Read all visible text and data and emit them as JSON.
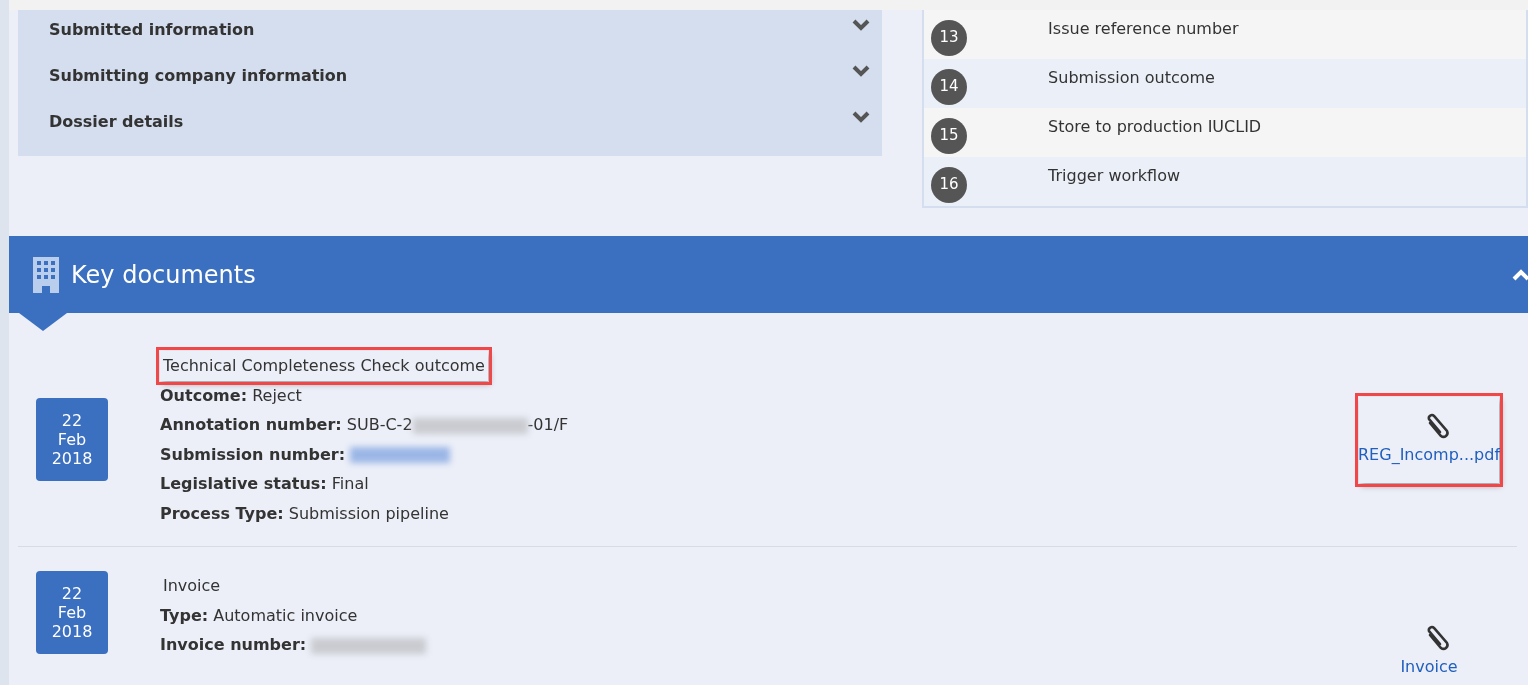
{
  "accordion": [
    {
      "title": "Submitted information",
      "expanded": false
    },
    {
      "title": "Submitting company information",
      "expanded": false
    },
    {
      "title": "Dossier details",
      "expanded": false
    }
  ],
  "steps": [
    {
      "number": "13",
      "label": "Issue reference number"
    },
    {
      "number": "14",
      "label": "Submission outcome"
    },
    {
      "number": "15",
      "label": "Store to production IUCLID"
    },
    {
      "number": "16",
      "label": "Trigger workflow"
    }
  ],
  "section": {
    "title": "Key documents",
    "expanded": true
  },
  "documents": [
    {
      "day": "22",
      "month": "Feb",
      "year": "2018",
      "title": "Technical Completeness Check outcome",
      "title_highlighted": true,
      "fields": [
        {
          "label": "Outcome:",
          "parts": [
            {
              "kind": "text",
              "text": "Reject"
            }
          ]
        },
        {
          "label": "Annotation number:",
          "parts": [
            {
              "kind": "text",
              "text": "SUB-C-2"
            },
            {
              "kind": "redacted"
            },
            {
              "kind": "text",
              "text": "-01/F"
            }
          ]
        },
        {
          "label": "Submission number:",
          "parts": [
            {
              "kind": "redacted-link"
            }
          ]
        },
        {
          "label": "Legislative status:",
          "parts": [
            {
              "kind": "text",
              "text": "Final"
            }
          ]
        },
        {
          "label": "Process Type:",
          "parts": [
            {
              "kind": "text",
              "text": "Submission pipeline"
            }
          ]
        }
      ],
      "attachment": {
        "label": "REG_Incomp...pdf",
        "highlighted": true
      }
    },
    {
      "day": "22",
      "month": "Feb",
      "year": "2018",
      "title": "Invoice",
      "title_highlighted": false,
      "fields": [
        {
          "label": "Type:",
          "parts": [
            {
              "kind": "text",
              "text": "Automatic invoice"
            }
          ]
        },
        {
          "label": "Invoice number:",
          "parts": [
            {
              "kind": "redacted"
            }
          ]
        }
      ],
      "attachment": {
        "label": "Invoice",
        "highlighted": false
      }
    }
  ]
}
